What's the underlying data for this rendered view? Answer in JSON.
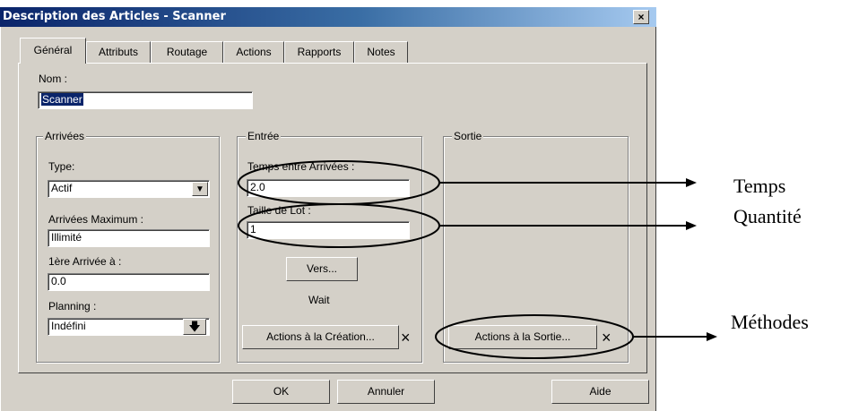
{
  "window": {
    "title": "Description des Articles - Scanner",
    "close_glyph": "×"
  },
  "tabs": [
    {
      "label": "Général",
      "active": true
    },
    {
      "label": "Attributs"
    },
    {
      "label": "Routage"
    },
    {
      "label": "Actions"
    },
    {
      "label": "Rapports"
    },
    {
      "label": "Notes"
    }
  ],
  "name": {
    "label": "Nom :",
    "value": "Scanner"
  },
  "arrivals": {
    "title": "Arrivées",
    "type_label": "Type:",
    "type_value": "Actif",
    "max_label": "Arrivées Maximum :",
    "max_value": "Illimité",
    "first_label": "1ère Arrivée à :",
    "first_value": "0.0",
    "planning_label": "Planning :",
    "planning_value": "Indéfini"
  },
  "entry": {
    "title": "Entrée",
    "time_label": "Temps entre Arrivées :",
    "time_value": "2.0",
    "lot_label": "Taille de Lot :",
    "lot_value": "1",
    "vers_label": "Vers...",
    "wait_text": "Wait",
    "create_actions_label": "Actions à la Création...",
    "x_glyph": "×"
  },
  "exit": {
    "title": "Sortie",
    "exit_actions_label": "Actions à la Sortie...",
    "x_glyph": "×"
  },
  "buttons": {
    "ok": "OK",
    "cancel": "Annuler",
    "help": "Aide"
  },
  "annotations": {
    "temps": "Temps",
    "quantite": "Quantité",
    "methodes": "Méthodes"
  }
}
